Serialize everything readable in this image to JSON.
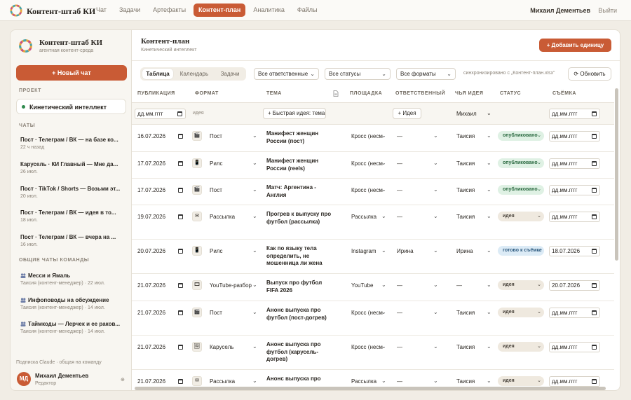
{
  "topbar": {
    "brand": "Контент-штаб КИ",
    "nav": [
      "Чат",
      "Задачи",
      "Артефакты",
      "Контент-план",
      "Аналитика",
      "Файлы"
    ],
    "active_nav": "Контент-план",
    "user": "Михаил Дементьев",
    "logout": "Выйти"
  },
  "sidebar": {
    "title": "Контент-штаб КИ",
    "subtitle": "агентная контент-среда",
    "new_chat": "+ Новый чат",
    "project_label": "ПРОЕКТ",
    "project": "Кинетический интеллект",
    "chats_label": "ЧАТЫ",
    "chats": [
      {
        "title": "Пост · Телеграм / ВК — на базе ко...",
        "date": "22 ч назад"
      },
      {
        "title": "Карусель · КИ Главный — Мне да...",
        "date": "26 июл."
      },
      {
        "title": "Пост · TikTok / Shorts — Возьми эт...",
        "date": "20 июл."
      },
      {
        "title": "Пост · Телеграм / ВК — идея в то...",
        "date": "18 июл."
      },
      {
        "title": "Пост · Телеграм / ВК — вчера на ...",
        "date": "16 июл."
      }
    ],
    "team_label": "ОБЩИЕ ЧАТЫ КОМАНДЫ",
    "team_chats": [
      {
        "title": "Месси и Ямаль",
        "meta": "Таисия (контент-менеджер) · 22 июл."
      },
      {
        "title": "Инфоповоды на обсуждение",
        "meta": "Таисия (контент-менеджер) · 14 июл."
      },
      {
        "title": "Таймкоды — Лерчек и ее раков...",
        "meta": "Таисия (контент-менеджер) · 14 июл."
      }
    ],
    "footer_note": "Подписка Claude · общая на команду",
    "user_initials": "МД",
    "user_name": "Михаил Дементьев",
    "user_role": "Редактор",
    "collapse": "⊕"
  },
  "main": {
    "title": "Контент-план",
    "subtitle": "Кинетический интеллект",
    "add_button": "+ Добавить единицу",
    "views": [
      "Таблица",
      "Календарь",
      "Задачи"
    ],
    "filters": [
      "Все ответственные",
      "Все статусы",
      "Все форматы"
    ],
    "sync": "синхронизировано с „Контент-план.xlsx“",
    "refresh": "⟳ Обновить",
    "headers": [
      "ПУБЛИКАЦИЯ",
      "ФОРМАТ",
      "ТЕМА",
      "ПЛОЩАДКА",
      "ОТВЕТСТВЕННЫЙ",
      "ЧЬЯ ИДЕЯ",
      "СТАТУС",
      "СЪЁМКА"
    ],
    "quick": {
      "date_placeholder": "дд.мм.гггг",
      "format_placeholder": "идея",
      "idea_input": "+ Быстрая идея: тема",
      "idea_button": "+ Идея",
      "author": "Михаил"
    },
    "rows": [
      {
        "date": "16.07.2026",
        "icon": "🎬",
        "format": "Пост",
        "theme": "Манифест женщин России (пост)",
        "platform": "Кросс (несм",
        "owner": "—",
        "idea": "Таисия",
        "status": "опубликовано",
        "status_type": "pub",
        "shoot": "дд.мм.гггг"
      },
      {
        "date": "17.07.2026",
        "icon": "📱",
        "format": "Рилс",
        "theme": "Манифест женщин России (reels)",
        "platform": "Кросс (несм",
        "owner": "—",
        "idea": "Таисия",
        "status": "опубликовано",
        "status_type": "pub",
        "shoot": "дд.мм.гггг"
      },
      {
        "date": "17.07.2026",
        "icon": "🎬",
        "format": "Пост",
        "theme": "Матч: Аргентина - Англия",
        "platform": "Кросс (несм",
        "owner": "—",
        "idea": "Таисия",
        "status": "опубликовано",
        "status_type": "pub",
        "shoot": "дд.мм.гггг"
      },
      {
        "date": "19.07.2026",
        "icon": "✉",
        "format": "Рассылка",
        "theme": "Прогрев к выпуску про футбол (рассылка)",
        "platform": "Рассылка",
        "owner": "—",
        "idea": "Таисия",
        "status": "идея",
        "status_type": "idea",
        "shoot": "дд.мм.гггг"
      },
      {
        "date": "20.07.2026",
        "icon": "📱",
        "format": "Рилс",
        "theme": "Как по языку тела определить, не мошенница ли жена",
        "platform": "Instagram",
        "owner": "Ирина",
        "idea": "Ирина",
        "status": "готово к съёмке",
        "status_type": "ready",
        "shoot": "18.07.2026"
      },
      {
        "date": "21.07.2026",
        "icon": "🎞",
        "format": "YouTube-разбор",
        "theme": "Выпуск про футбол FIFA 2026",
        "platform": "YouTube",
        "owner": "—",
        "idea": "—",
        "status": "идея",
        "status_type": "idea",
        "shoot": "20.07.2026"
      },
      {
        "date": "21.07.2026",
        "icon": "🎬",
        "format": "Пост",
        "theme": "Анонс выпуска про футбол (пост-догрев)",
        "platform": "Кросс (несм",
        "owner": "—",
        "idea": "Таисия",
        "status": "идея",
        "status_type": "idea",
        "shoot": "дд.мм.гггг"
      },
      {
        "date": "21.07.2026",
        "icon": "🖼",
        "format": "Карусель",
        "theme": "Анонс выпуска про футбол (карусель-догрев)",
        "platform": "Кросс (несм",
        "owner": "—",
        "idea": "Таисия",
        "status": "идея",
        "status_type": "idea",
        "shoot": "дд.мм.гггг"
      },
      {
        "date": "21.07.2026",
        "icon": "✉",
        "format": "Рассылка",
        "theme": "Анонс выпуска про",
        "platform": "Рассылка",
        "owner": "—",
        "idea": "Таисия",
        "status": "идея",
        "status_type": "idea",
        "shoot": "дд.мм.гггг"
      }
    ]
  },
  "colors": {
    "accent": "#c95b35",
    "published": "#dff1e4",
    "idea": "#efe9df",
    "ready": "#dcebf6"
  }
}
